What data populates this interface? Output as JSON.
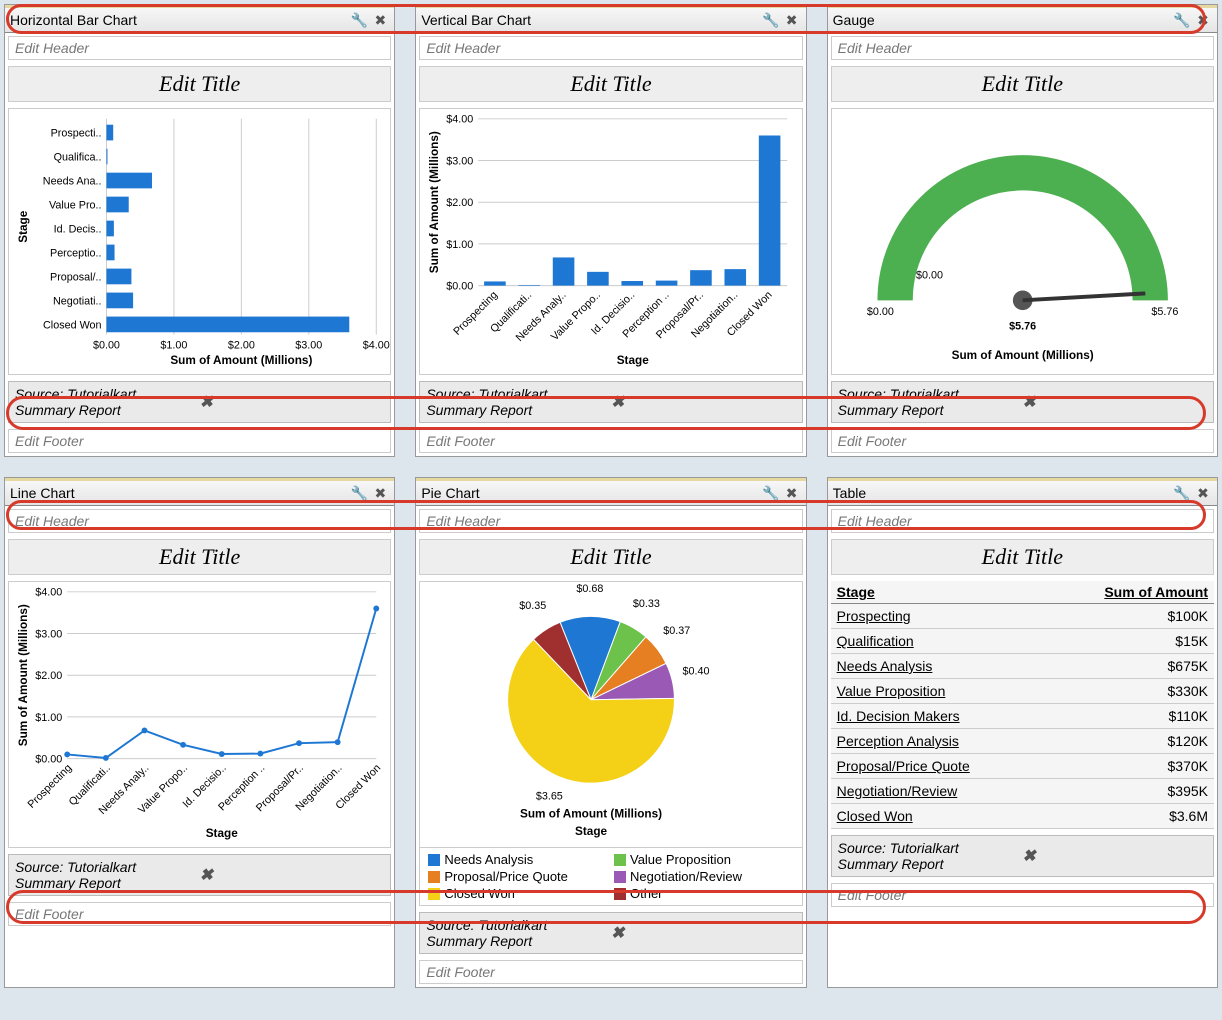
{
  "widgets": [
    {
      "type": "Horizontal Bar Chart"
    },
    {
      "type": "Vertical Bar Chart"
    },
    {
      "type": "Gauge"
    },
    {
      "type": "Line Chart"
    },
    {
      "type": "Pie Chart"
    },
    {
      "type": "Table"
    }
  ],
  "common": {
    "editHeader": "Edit Header",
    "editTitle": "Edit Title",
    "editFooter": "Edit Footer",
    "source": "Source: Tutorialkart Summary Report"
  },
  "gauge": {
    "min": "$0.00",
    "minTick": "$0.00",
    "max": "$5.76",
    "value": "$5.76",
    "label": "Sum of Amount (Millions)"
  },
  "table": {
    "headers": [
      "Stage",
      "Sum of Amount"
    ],
    "rows": [
      [
        "Prospecting",
        "$100K"
      ],
      [
        "Qualification",
        "$15K"
      ],
      [
        "Needs Analysis",
        "$675K"
      ],
      [
        "Value Proposition",
        "$330K"
      ],
      [
        "Id. Decision Makers",
        "$110K"
      ],
      [
        "Perception Analysis",
        "$120K"
      ],
      [
        "Proposal/Price Quote",
        "$370K"
      ],
      [
        "Negotiation/Review",
        "$395K"
      ],
      [
        "Closed Won",
        "$3.6M"
      ]
    ]
  },
  "pie": {
    "title": "Sum of Amount (Millions)",
    "sub": "Stage",
    "slices": [
      {
        "label": "$0.68",
        "color": "#1f77d4",
        "legend": "Needs Analysis"
      },
      {
        "label": "$0.33",
        "color": "#6cc24a",
        "legend": "Value Proposition"
      },
      {
        "label": "$0.37",
        "color": "#e67e22",
        "legend": "Proposal/Price Quote"
      },
      {
        "label": "$0.40",
        "color": "#9b59b6",
        "legend": "Negotiation/Review"
      },
      {
        "label": "$3.65",
        "color": "#f4d017",
        "legend": "Closed Won"
      },
      {
        "label": "$0.35",
        "color": "#a03030",
        "legend": "Other"
      }
    ]
  },
  "stages_short": [
    "Prospecti..",
    "Qualifica..",
    "Needs Ana..",
    "Value Pro..",
    "Id. Decis..",
    "Perceptio..",
    "Proposal/..",
    "Negotiati..",
    "Closed Won"
  ],
  "stages_rot": [
    "Prospecting",
    "Qualificati..",
    "Needs Analy..",
    "Value Propo..",
    "Id. Decisio..",
    "Perception ..",
    "Proposal/Pr..",
    "Negotiation..",
    "Closed Won"
  ],
  "axis_hbar": {
    "label": "Sum of Amount (Millions)",
    "ylabel": "Stage",
    "ticks": [
      "$0.00",
      "$1.00",
      "$2.00",
      "$3.00",
      "$4.00"
    ]
  },
  "axis_vbar": {
    "label": "Stage",
    "ylabel": "Sum of Amount (Millions)",
    "ticks": [
      "$0.00",
      "$1.00",
      "$2.00",
      "$3.00",
      "$4.00"
    ]
  },
  "chart_data": [
    {
      "type": "bar",
      "orientation": "horizontal",
      "title": "Edit Title",
      "xlabel": "Sum of Amount (Millions)",
      "ylabel": "Stage",
      "xlim": [
        0,
        4
      ],
      "categories": [
        "Prospecting",
        "Qualification",
        "Needs Analysis",
        "Value Proposition",
        "Id. Decision Makers",
        "Perception Analysis",
        "Proposal/Price Quote",
        "Negotiation/Review",
        "Closed Won"
      ],
      "values": [
        0.1,
        0.015,
        0.675,
        0.33,
        0.11,
        0.12,
        0.37,
        0.395,
        3.6
      ]
    },
    {
      "type": "bar",
      "orientation": "vertical",
      "title": "Edit Title",
      "xlabel": "Stage",
      "ylabel": "Sum of Amount (Millions)",
      "ylim": [
        0,
        4
      ],
      "categories": [
        "Prospecting",
        "Qualification",
        "Needs Analysis",
        "Value Proposition",
        "Id. Decision Makers",
        "Perception Analysis",
        "Proposal/Price Quote",
        "Negotiation/Review",
        "Closed Won"
      ],
      "values": [
        0.1,
        0.015,
        0.675,
        0.33,
        0.11,
        0.12,
        0.37,
        0.395,
        3.6
      ]
    },
    {
      "type": "gauge",
      "title": "Edit Title",
      "label": "Sum of Amount (Millions)",
      "min": 0,
      "max": 5.76,
      "value": 5.76
    },
    {
      "type": "line",
      "title": "Edit Title",
      "xlabel": "Stage",
      "ylabel": "Sum of Amount (Millions)",
      "ylim": [
        0,
        4
      ],
      "categories": [
        "Prospecting",
        "Qualification",
        "Needs Analysis",
        "Value Proposition",
        "Id. Decision Makers",
        "Perception Analysis",
        "Proposal/Price Quote",
        "Negotiation/Review",
        "Closed Won"
      ],
      "values": [
        0.1,
        0.015,
        0.675,
        0.33,
        0.11,
        0.12,
        0.37,
        0.395,
        3.6
      ]
    },
    {
      "type": "pie",
      "title": "Sum of Amount (Millions)",
      "sub": "Stage",
      "series": [
        {
          "name": "Needs Analysis",
          "value": 0.68
        },
        {
          "name": "Value Proposition",
          "value": 0.33
        },
        {
          "name": "Proposal/Price Quote",
          "value": 0.37
        },
        {
          "name": "Negotiation/Review",
          "value": 0.4
        },
        {
          "name": "Closed Won",
          "value": 3.65
        },
        {
          "name": "Other",
          "value": 0.35
        }
      ]
    },
    {
      "type": "table",
      "columns": [
        "Stage",
        "Sum of Amount"
      ],
      "rows": [
        [
          "Prospecting",
          "$100K"
        ],
        [
          "Qualification",
          "$15K"
        ],
        [
          "Needs Analysis",
          "$675K"
        ],
        [
          "Value Proposition",
          "$330K"
        ],
        [
          "Id. Decision Makers",
          "$110K"
        ],
        [
          "Perception Analysis",
          "$120K"
        ],
        [
          "Proposal/Price Quote",
          "$370K"
        ],
        [
          "Negotiation/Review",
          "$395K"
        ],
        [
          "Closed Won",
          "$3.6M"
        ]
      ]
    }
  ]
}
